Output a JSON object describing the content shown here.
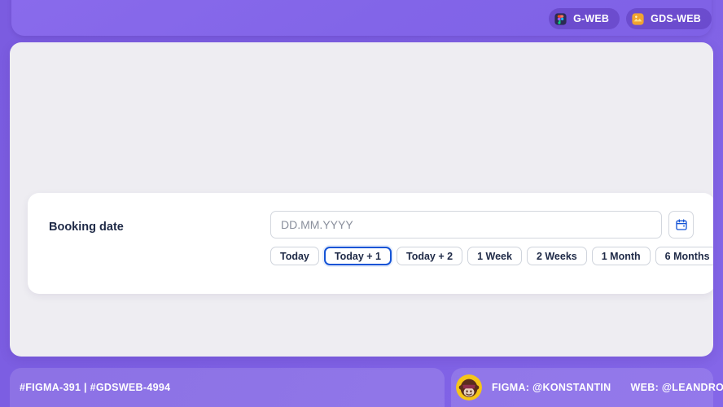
{
  "header": {
    "badges": [
      {
        "label": "G-WEB",
        "icon": "figma-logo-icon"
      },
      {
        "label": "GDS-WEB",
        "icon": "gds-logo-icon"
      }
    ]
  },
  "main": {
    "card": {
      "label": "Booking date",
      "date_input": {
        "value": "",
        "placeholder": "DD.MM.YYYY",
        "calendar_icon": "calendar-icon"
      },
      "quick_chips": [
        {
          "label": "Today",
          "selected": false
        },
        {
          "label": "Today + 1",
          "selected": true
        },
        {
          "label": "Today + 2",
          "selected": false
        },
        {
          "label": "1 Week",
          "selected": false
        },
        {
          "label": "2 Weeks",
          "selected": false
        },
        {
          "label": "1 Month",
          "selected": false
        },
        {
          "label": "6 Months",
          "selected": false
        }
      ]
    }
  },
  "footer": {
    "ticket": "#FIGMA-391 | #GDSWEB-4994",
    "figma_credit": "FIGMA: @KONSTANTIN",
    "web_credit": "WEB: @LEANDRO",
    "figma_avatar": "monkey-avatar",
    "web_avatar": "person-avatar"
  },
  "colors": {
    "brand_purple": "#7d5fe3",
    "panel_gray": "#eeedf2",
    "accent_blue": "#1554d6",
    "text_dark": "#1f2a47",
    "placeholder_gray": "#8a8f9c"
  }
}
